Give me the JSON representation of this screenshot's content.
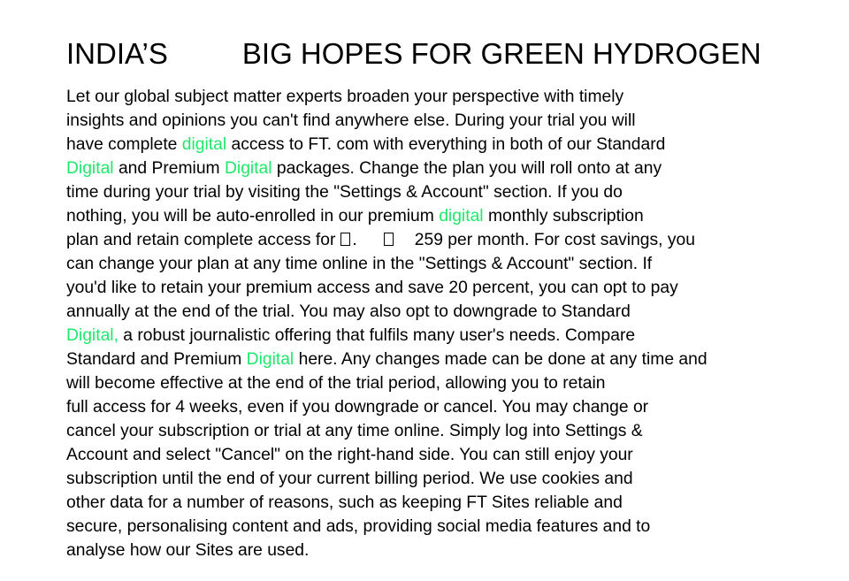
{
  "article": {
    "headline_part1": "INDIA’S",
    "headline_part2": "BIG HOPES FOR GREEN HYDROGEN",
    "lines": [
      [
        {
          "t": "Let our global subject matter experts broaden your perspective with timely"
        }
      ],
      [
        {
          "t": "insights and opinions you can't find anywhere else. During your trial you will"
        }
      ],
      [
        {
          "t": "have complete "
        },
        {
          "t": "digital",
          "hl": true
        },
        {
          "t": " access to FT. com with everything in both of our Standard"
        }
      ],
      [
        {
          "t": "Digital",
          "hl": true
        },
        {
          "t": " and Premium "
        },
        {
          "t": "Digital",
          "hl": true
        },
        {
          "t": " packages. Change the plan you will roll onto at any"
        }
      ],
      [
        {
          "t": "time during your trial by visiting the \"Settings & Account\" section. If you do"
        }
      ],
      [
        {
          "t": "nothing, you will be auto-enrolled in our premium "
        },
        {
          "t": "digital",
          "hl": true
        },
        {
          "t": " monthly subscription"
        }
      ],
      [
        {
          "t": "plan and retain complete access for"
        },
        {
          "g": "glyph"
        },
        {
          "t": "."
        },
        {
          "g": "glyph-wide"
        },
        {
          "t": "259 per month. For cost savings, you"
        }
      ],
      [
        {
          "t": "can change your plan at any time online in the \"Settings & Account\" section. If"
        }
      ],
      [
        {
          "t": "you'd like to retain your premium access and save 20 percent, you can opt to pay"
        }
      ],
      [
        {
          "t": "annually at the end of the trial. You may also opt to downgrade to Standard"
        }
      ],
      [
        {
          "t": "Digital,",
          "hl": true
        },
        {
          "t": " a robust journalistic offering that fulfils many user's needs. Compare"
        }
      ],
      [
        {
          "t": "Standard and Premium "
        },
        {
          "t": "Digital",
          "hl": true
        },
        {
          "t": " here. Any changes made can be done at any time and"
        }
      ],
      [
        {
          "t": "will become effective at the end of the trial period, allowing you to retain"
        }
      ],
      [
        {
          "t": "full access for 4 weeks, even if you downgrade or cancel. You may change or"
        }
      ],
      [
        {
          "t": "cancel your subscription or trial at any time online. Simply log into Settings &"
        }
      ],
      [
        {
          "t": "Account and select \"Cancel\" on the right-hand side. You can still enjoy your"
        }
      ],
      [
        {
          "t": "subscription until the end of your current billing period. We use cookies and"
        }
      ],
      [
        {
          "t": "other data for a number of reasons, such as keeping FT Sites reliable and"
        }
      ],
      [
        {
          "t": "secure, personalising content and ads, providing social media features and to"
        }
      ],
      [
        {
          "t": "analyse how our Sites are used."
        }
      ]
    ]
  },
  "colors": {
    "highlight": "#1ee86a",
    "text": "#000000",
    "background": "#ffffff"
  }
}
